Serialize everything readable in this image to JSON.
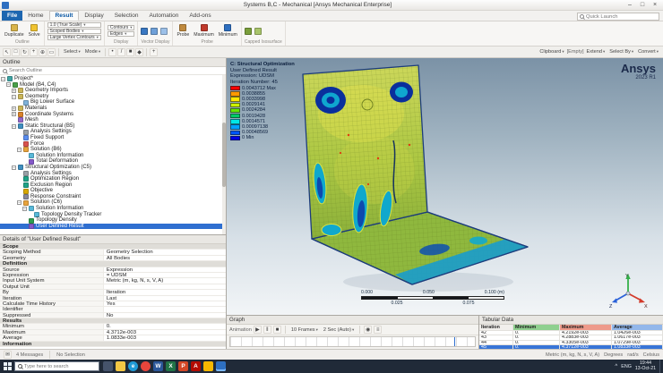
{
  "window": {
    "title": "Systems B,C - Mechanical [Ansys Mechanical Enterprise]",
    "minimize": "–",
    "maximize": "□",
    "close": "×"
  },
  "quick_launch": {
    "placeholder": "Quick Launch"
  },
  "ribbon": {
    "tabs": [
      {
        "label": "File",
        "file": true
      },
      {
        "label": "Home"
      },
      {
        "label": "Result",
        "active": true
      },
      {
        "label": "Display"
      },
      {
        "label": "Selection"
      },
      {
        "label": "Automation"
      },
      {
        "label": "Add-ons"
      }
    ],
    "groups": [
      {
        "label": "Outline",
        "items": [
          {
            "t": "big",
            "label": "Duplicate",
            "icon": "duplicate-icon",
            "color": "#d9b44a"
          },
          {
            "t": "big",
            "label": "Solve",
            "icon": "solve-icon",
            "color": "#f0c330"
          }
        ]
      },
      {
        "label": "",
        "stack": true,
        "items": [
          {
            "t": "drop",
            "label": "1.0 (True Scale)"
          },
          {
            "t": "drop",
            "label": "Scoped Bodies"
          },
          {
            "t": "drop",
            "label": "Large Vertex Contours"
          }
        ]
      },
      {
        "label": "Display",
        "stack": true,
        "items": [
          {
            "t": "drop",
            "label": "Contours"
          },
          {
            "t": "drop",
            "label": "Edges"
          }
        ]
      },
      {
        "label": "Vector Display",
        "items": [
          {
            "t": "icon",
            "icon": "vector-plot-icon",
            "color": "#3a78c2"
          },
          {
            "t": "icon",
            "icon": "vector-uniform-icon",
            "color": "#6fa0d8"
          },
          {
            "t": "icon",
            "icon": "vector-grid-icon",
            "color": "#9cc0e8"
          }
        ]
      },
      {
        "label": "Probe",
        "items": [
          {
            "t": "big",
            "label": "Probe",
            "icon": "probe-icon",
            "color": "#c08a3e"
          },
          {
            "t": "big",
            "label": "Maximum",
            "icon": "maximum-icon",
            "color": "#c0392b"
          },
          {
            "t": "big",
            "label": "Minimum",
            "icon": "minimum-icon",
            "color": "#2e6fc0"
          }
        ]
      },
      {
        "label": "Capped Isosurface",
        "items": [
          {
            "t": "icon",
            "icon": "capped-isosurface-icon",
            "color": "#7a9e3b"
          },
          {
            "t": "icon",
            "icon": "capping-style-icon",
            "color": "#a8c46a"
          }
        ]
      }
    ]
  },
  "toolbar": {
    "items": [
      {
        "icon": "cursor-icon",
        "glyph": "↖"
      },
      {
        "icon": "box-select-icon",
        "glyph": "□"
      },
      {
        "icon": "rotate-icon",
        "glyph": "↻"
      },
      {
        "icon": "pan-icon",
        "glyph": "+"
      },
      {
        "icon": "zoom-icon",
        "glyph": "⊕"
      },
      {
        "icon": "zoom-fit-icon",
        "glyph": "▭"
      },
      {
        "sep": true
      },
      {
        "drop": "Select"
      },
      {
        "drop": "Mode"
      },
      {
        "sep": true
      },
      {
        "icon": "vertex-filter-icon",
        "glyph": "•"
      },
      {
        "icon": "edge-filter-icon",
        "glyph": "/"
      },
      {
        "icon": "face-filter-icon",
        "glyph": "■"
      },
      {
        "icon": "body-filter-icon",
        "glyph": "◆"
      },
      {
        "sep": true
      },
      {
        "icon": "extend-selection-icon",
        "glyph": "+"
      },
      {
        "spacer": true
      },
      {
        "drop": "Clipboard"
      },
      {
        "label": "[Empty]"
      },
      {
        "drop": "Extend"
      },
      {
        "drop": "Select By"
      },
      {
        "drop": "Convert"
      }
    ]
  },
  "outline": {
    "title": "Outline",
    "search_placeholder": "Search Outline",
    "items": [
      {
        "i": 0,
        "e": "-",
        "ic": "project",
        "label": "Project*"
      },
      {
        "i": 1,
        "e": "-",
        "ic": "model",
        "label": "Model (B4, C4)"
      },
      {
        "i": 2,
        "e": "+",
        "ic": "folder",
        "label": "Geometry Imports"
      },
      {
        "i": 2,
        "e": "-",
        "ic": "folder",
        "label": "Geometry"
      },
      {
        "i": 3,
        "ic": "body",
        "label": "Big Lower Surface"
      },
      {
        "i": 2,
        "e": "+",
        "ic": "folder",
        "label": "Materials"
      },
      {
        "i": 2,
        "e": "+",
        "ic": "csys",
        "label": "Coordinate Systems"
      },
      {
        "i": 2,
        "ic": "mesh",
        "label": "Mesh"
      },
      {
        "i": 2,
        "e": "-",
        "ic": "analysis",
        "label": "Static Structural (B5)"
      },
      {
        "i": 3,
        "ic": "settings",
        "label": "Analysis Settings"
      },
      {
        "i": 3,
        "ic": "support",
        "label": "Fixed Support"
      },
      {
        "i": 3,
        "ic": "force",
        "label": "Force"
      },
      {
        "i": 3,
        "e": "-",
        "ic": "solution",
        "label": "Solution (B6)"
      },
      {
        "i": 4,
        "ic": "info",
        "label": "Solution Information"
      },
      {
        "i": 4,
        "ic": "result",
        "label": "Total Deformation"
      },
      {
        "i": 2,
        "e": "-",
        "ic": "analysis",
        "label": "Structural Optimization (C5)"
      },
      {
        "i": 3,
        "ic": "settings",
        "label": "Analysis Settings"
      },
      {
        "i": 3,
        "ic": "region",
        "label": "Optimization Region"
      },
      {
        "i": 3,
        "ic": "region",
        "label": "Exclusion Region"
      },
      {
        "i": 3,
        "ic": "objective",
        "label": "Objective"
      },
      {
        "i": 3,
        "ic": "constraint",
        "label": "Response Constraint"
      },
      {
        "i": 3,
        "e": "-",
        "ic": "solution",
        "label": "Solution (C6)"
      },
      {
        "i": 4,
        "e": "-",
        "ic": "info",
        "label": "Solution Information"
      },
      {
        "i": 5,
        "ic": "tracker",
        "label": "Topology Density Tracker"
      },
      {
        "i": 4,
        "ic": "density",
        "label": "Topology Density"
      },
      {
        "i": 4,
        "ic": "result",
        "label": "User Defined Result",
        "sel": true
      }
    ]
  },
  "details": {
    "title": "Details of \"User Defined Result\"",
    "rows": [
      {
        "cat": "Scope"
      },
      {
        "l": "Scoping Method",
        "v": "Geometry Selection"
      },
      {
        "l": "Geometry",
        "v": "All Bodies"
      },
      {
        "cat": "Definition"
      },
      {
        "l": "Source",
        "v": "Expression"
      },
      {
        "l": "Expression",
        "v": "= UDSM"
      },
      {
        "l": "Input Unit System",
        "v": "Metric (m, kg, N, s, V, A)"
      },
      {
        "l": "Output Unit",
        "v": ""
      },
      {
        "l": "By",
        "v": "Iteration"
      },
      {
        "l": "Iteration",
        "v": "Last"
      },
      {
        "l": "Calculate Time History",
        "v": "Yes"
      },
      {
        "l": "Identifier",
        "v": ""
      },
      {
        "l": "Suppressed",
        "v": "No"
      },
      {
        "cat": "Results"
      },
      {
        "l": "Minimum",
        "v": "0."
      },
      {
        "l": "Maximum",
        "v": "4.3712e-003"
      },
      {
        "l": "Average",
        "v": "1.0833e-003"
      },
      {
        "cat": "Information"
      }
    ]
  },
  "viewport": {
    "logo": {
      "brand": "Ansys",
      "version": "2023 R1"
    },
    "legend": {
      "header": [
        "C: Structural Optimization",
        "User Defined Result",
        "Expression: UDSM",
        "Iteration Number: 45"
      ],
      "entries": [
        {
          "c": "#ff0000",
          "v": "0.0043712 Max"
        },
        {
          "c": "#ff9900",
          "v": "0.0038855"
        },
        {
          "c": "#ffe600",
          "v": "0.0033998"
        },
        {
          "c": "#ccf200",
          "v": "0.0029141"
        },
        {
          "c": "#66e600",
          "v": "0.0024284"
        },
        {
          "c": "#00cc66",
          "v": "0.0019428"
        },
        {
          "c": "#00e6e6",
          "v": "0.0014571"
        },
        {
          "c": "#00a2ff",
          "v": "0.00097138"
        },
        {
          "c": "#0055ff",
          "v": "0.00048569"
        },
        {
          "c": "#0000e6",
          "v": "0 Min"
        }
      ]
    },
    "ruler": {
      "top": [
        "0.000",
        "0.050",
        "0.100 (m)"
      ],
      "bottom": [
        "0.025",
        "0.075"
      ]
    },
    "triad": {
      "x": "X",
      "y": "Y",
      "z": "Z"
    }
  },
  "graph": {
    "title": "Graph",
    "toolbar": [
      {
        "label": "Animation"
      },
      {
        "icon": "play-icon",
        "glyph": "▶"
      },
      {
        "icon": "pause-icon",
        "glyph": "‖"
      },
      {
        "icon": "stop-icon",
        "glyph": "■"
      },
      {
        "sep": true
      },
      {
        "drop": "10 Frames"
      },
      {
        "drop": "2 Sec (Auto)"
      },
      {
        "sep": true
      },
      {
        "icon": "export-video-icon",
        "glyph": "◉"
      },
      {
        "icon": "result-chart-icon",
        "glyph": "≡"
      }
    ]
  },
  "tabular": {
    "title": "Tabular Data",
    "columns": [
      {
        "label": "Iteration"
      },
      {
        "label": "Minimum",
        "color": "#8fd08f"
      },
      {
        "label": "Maximum",
        "color": "#ee9a8a"
      },
      {
        "label": "Average",
        "color": "#93b7ea"
      }
    ],
    "rows": [
      [
        "42",
        "0.",
        "4.2192e-003",
        "1.0426e-003"
      ],
      [
        "43",
        "0.",
        "4.2883e-003",
        "1.0617e-003"
      ],
      [
        "44",
        "0.",
        "4.3305e-003",
        "1.0729e-003"
      ],
      [
        "45",
        "0.",
        "4.3712e-003",
        "1.0833e-003"
      ]
    ],
    "selected_row": 3
  },
  "status": {
    "left": [
      {
        "icon": "messages-icon",
        "glyph": "✉",
        "click": true
      },
      {
        "label": "4 Messages"
      },
      {
        "sep": true
      },
      {
        "label": "No Selection"
      }
    ],
    "right": [
      {
        "label": "Metric (m, kg, N, s, V, A)"
      },
      {
        "label": "Degrees"
      },
      {
        "label": "rad/s"
      },
      {
        "label": "Celsius"
      }
    ]
  },
  "taskbar": {
    "search_placeholder": "Type here to search",
    "icons": [
      {
        "name": "task-view-icon",
        "color": "#45536b"
      },
      {
        "name": "file-explorer-icon",
        "color": "#f3c744"
      },
      {
        "name": "edge-icon",
        "color": "#1f9bd7",
        "glyph": "e",
        "round": true
      },
      {
        "name": "chrome-icon",
        "color": "#e8453c",
        "round": true
      },
      {
        "name": "word-icon",
        "color": "#2b579a",
        "glyph": "W"
      },
      {
        "name": "excel-icon",
        "color": "#217346",
        "glyph": "X"
      },
      {
        "name": "powerpoint-icon",
        "color": "#d24726",
        "glyph": "P"
      },
      {
        "name": "acrobat-icon",
        "color": "#b30b00",
        "glyph": "A"
      },
      {
        "name": "workbench-icon",
        "color": "#f5b800"
      },
      {
        "name": "mechanical-icon",
        "color": "#2e6fc0",
        "active": true
      }
    ],
    "tray": {
      "caret": "^",
      "lang": "ENG",
      "time": "19:44",
      "date": "13-Oct-21"
    }
  }
}
